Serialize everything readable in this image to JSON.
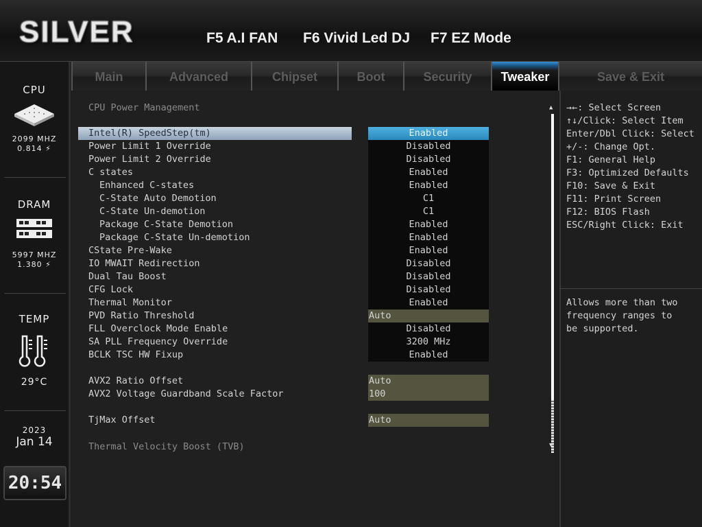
{
  "header": {
    "logo": "SILVER",
    "fkeys": [
      "F5 A.I FAN",
      "F6 Vivid Led DJ",
      "F7 EZ Mode"
    ]
  },
  "sidebar": {
    "cpu": {
      "title": "CPU",
      "freq": "2099 MHZ",
      "volt": "0.814 ⚡"
    },
    "dram": {
      "title": "DRAM",
      "freq": "5997 MHZ",
      "volt": "1.380 ⚡"
    },
    "temp": {
      "title": "TEMP",
      "value": "29°C"
    },
    "date": {
      "year": "2023",
      "day": "Jan 14"
    },
    "clock": "20:54"
  },
  "tabs": [
    "Main",
    "Advanced",
    "Chipset",
    "Boot",
    "Security",
    "Tweaker",
    "Save & Exit"
  ],
  "active_tab": "Tweaker",
  "main": {
    "section_title": "CPU Power Management",
    "rows": [
      {
        "label": "Intel(R) SpeedStep(tm)",
        "value": "Enabled",
        "selected": true
      },
      {
        "label": "Power Limit 1 Override",
        "value": "Disabled"
      },
      {
        "label": "Power Limit 2 Override",
        "value": "Disabled"
      },
      {
        "label": "C states",
        "value": "Enabled"
      },
      {
        "label": "Enhanced C-states",
        "value": "Enabled",
        "indent": true
      },
      {
        "label": "C-State Auto Demotion",
        "value": "C1",
        "indent": true
      },
      {
        "label": "C-State Un-demotion",
        "value": "C1",
        "indent": true
      },
      {
        "label": "Package C-State Demotion",
        "value": "Enabled",
        "indent": true
      },
      {
        "label": "Package C-State Un-demotion",
        "value": "Enabled",
        "indent": true
      },
      {
        "label": "CState Pre-Wake",
        "value": "Enabled"
      },
      {
        "label": "IO MWAIT Redirection",
        "value": "Disabled"
      },
      {
        "label": "Dual Tau Boost",
        "value": "Disabled"
      },
      {
        "label": "CFG Lock",
        "value": "Disabled"
      },
      {
        "label": "Thermal Monitor",
        "value": "Enabled"
      },
      {
        "label": "PVD Ratio Threshold",
        "value": "Auto",
        "input": true
      },
      {
        "label": "FLL Overclock Mode Enable",
        "value": "Disabled"
      },
      {
        "label": "SA PLL Frequency Override",
        "value": "3200 MHz"
      },
      {
        "label": "BCLK TSC HW Fixup",
        "value": "Enabled"
      },
      {
        "gap": true
      },
      {
        "label": "AVX2 Ratio Offset",
        "value": "Auto",
        "input": true
      },
      {
        "label": "AVX2 Voltage Guardband Scale Factor",
        "value": "100",
        "input": true
      },
      {
        "gap": true
      },
      {
        "label": "TjMax Offset",
        "value": "Auto",
        "input": true
      }
    ],
    "footer_section": "Thermal Velocity Boost (TVB)"
  },
  "help": {
    "keys": [
      "→←: Select Screen",
      "↑↓/Click: Select Item",
      "Enter/Dbl Click: Select",
      "+/-: Change Opt.",
      "F1: General Help",
      "F3: Optimized Defaults",
      "F10: Save & Exit",
      "F11: Print Screen",
      "F12: BIOS Flash",
      "ESC/Right Click: Exit"
    ],
    "description": [
      "Allows more than two",
      "frequency ranges to",
      "be supported."
    ]
  }
}
